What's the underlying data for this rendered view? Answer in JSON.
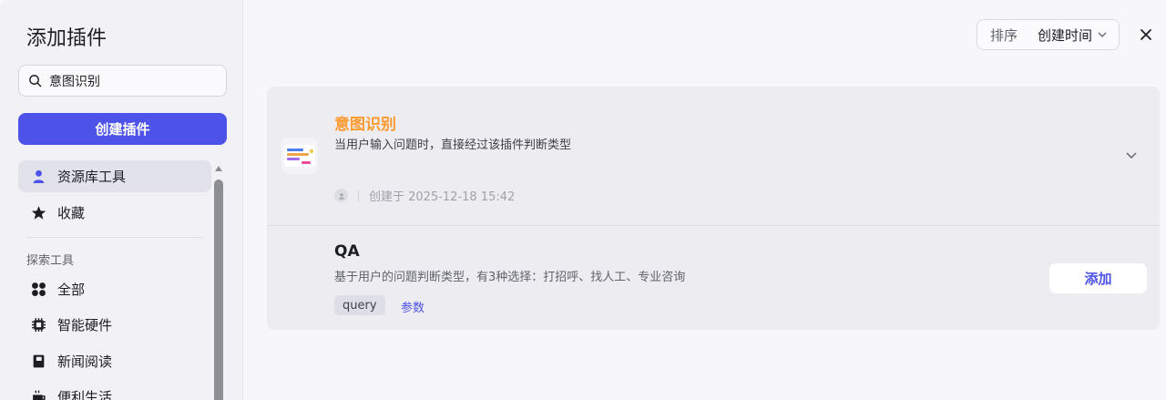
{
  "modal": {
    "title": "添加插件"
  },
  "search": {
    "value": "意图识别"
  },
  "create_button": {
    "label": "创建插件"
  },
  "sidebar": {
    "items": [
      {
        "label": "资源库工具",
        "icon": "user-icon",
        "active": true
      },
      {
        "label": "收藏",
        "icon": "star-icon",
        "active": false
      }
    ],
    "section_label": "探索工具",
    "explore_items": [
      {
        "label": "全部",
        "icon": "grid-icon"
      },
      {
        "label": "智能硬件",
        "icon": "chip-icon"
      },
      {
        "label": "新闻阅读",
        "icon": "book-icon"
      },
      {
        "label": "便利生活",
        "icon": "cup-icon"
      }
    ]
  },
  "sort": {
    "label": "排序",
    "value": "创建时间"
  },
  "plugin": {
    "name": "意图识别",
    "description": "当用户输入问题时，直接经过该插件判断类型",
    "created_label": "创建于 2025-12-18 15:42",
    "tool": {
      "name": "QA",
      "description": "基于用户的问题判断类型，有3种选择：打招呼、找人工、专业咨询",
      "param_tag": "query",
      "param_link": "参数",
      "add_label": "添加"
    }
  },
  "colors": {
    "accent": "#4d53e8",
    "plugin_name": "#ff9a2e"
  }
}
